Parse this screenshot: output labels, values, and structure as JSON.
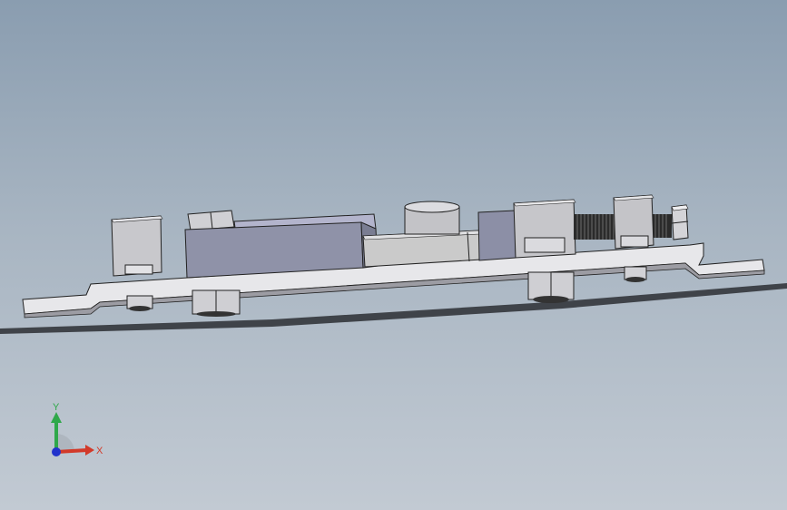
{
  "viewport": {
    "background_top": "#8a9db0",
    "background_bottom": "#c2cad3"
  },
  "model": {
    "plate_color": "#e4e4e6",
    "block_color": "#8e91a6",
    "metal_color": "#c9c9cc",
    "shadow_color": "#2b2e33",
    "components": [
      "base-plate",
      "left-bracket",
      "center-block",
      "cylinder-boss",
      "clamp-block",
      "threaded-rod",
      "nut",
      "hex-bolt-head",
      "mounting-bolt"
    ]
  },
  "triad": {
    "y_label": "Y",
    "x_label": "X",
    "y_color": "#2fa84a",
    "x_color": "#d23a2a",
    "z_color": "#2233cc",
    "icon": "coordinate-triad-icon"
  }
}
